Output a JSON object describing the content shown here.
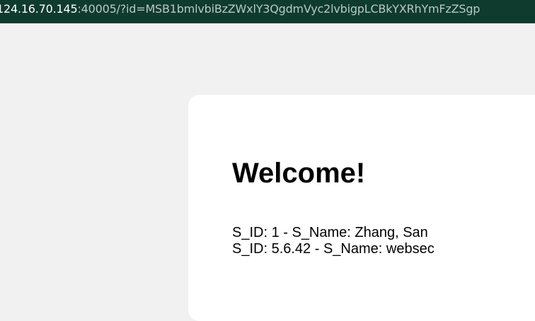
{
  "browser": {
    "url_host": "124.16.70.145",
    "url_rest": ":40005/?id=MSB1bmlvbiBzZWxlY3QgdmVyc2lvbigpLCBkYXRhYmFzZSgp"
  },
  "page": {
    "heading": "Welcome!",
    "results": [
      "S_ID: 1 - S_Name: Zhang, San",
      "S_ID: 5.6.42 - S_Name: websec"
    ]
  },
  "colors": {
    "address_bar": "#0f3b2f",
    "page_background": "#f1f1f1",
    "card_background": "#ffffff"
  }
}
